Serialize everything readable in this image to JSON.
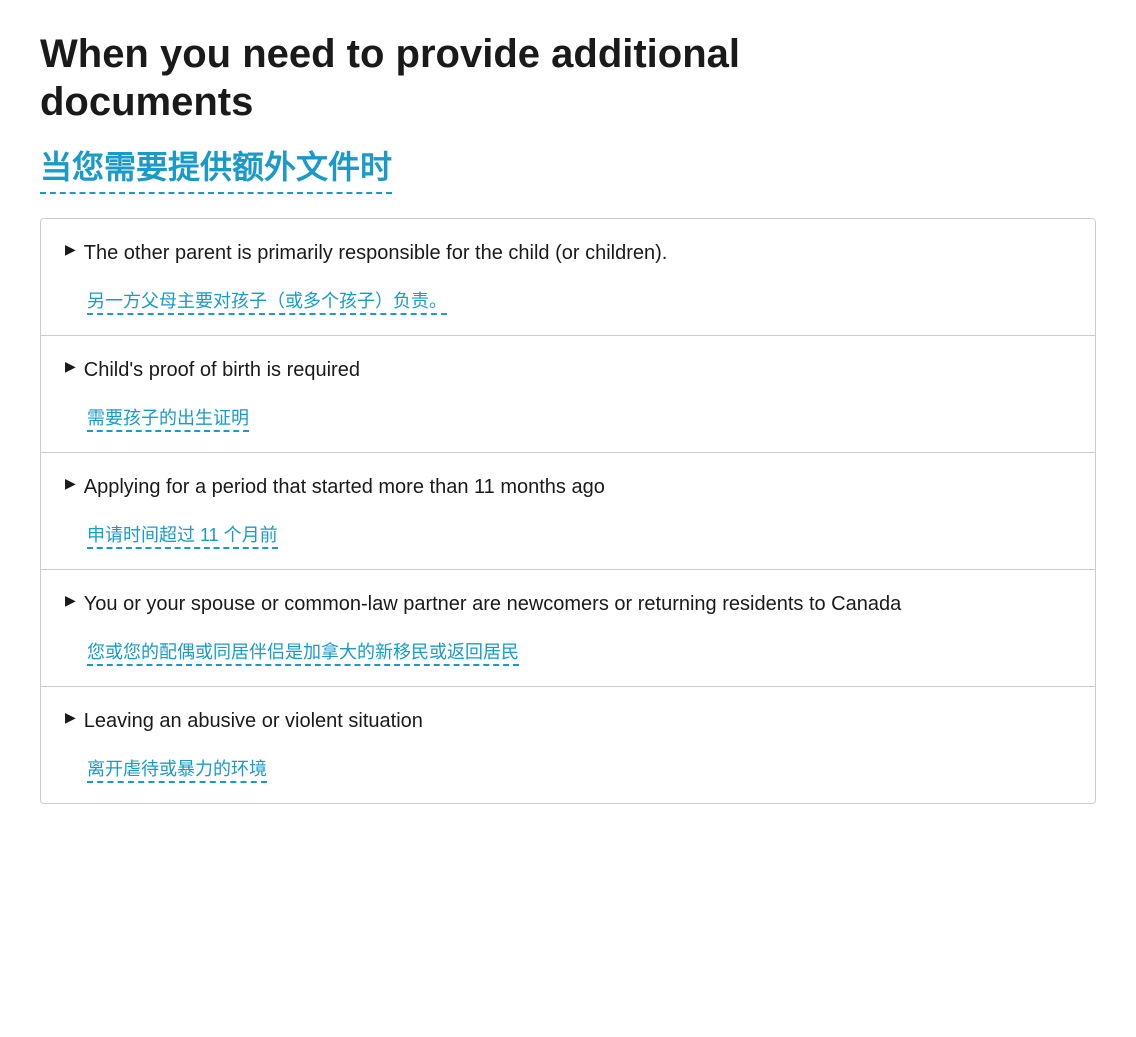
{
  "header": {
    "title_en_line1": "When you need to provide additional",
    "title_en_line2": "documents",
    "title_zh": "当您需要提供额外文件时"
  },
  "accordion": {
    "items": [
      {
        "id": "item-1",
        "title_en": "The other parent is primarily responsible for the child (or children).",
        "title_zh": "另一方父母主要对孩子（或多个孩子）负责。"
      },
      {
        "id": "item-2",
        "title_en": "Child's proof of birth is required",
        "title_zh": "需要孩子的出生证明"
      },
      {
        "id": "item-3",
        "title_en": "Applying for a period that started more than 11 months ago",
        "title_zh": "申请时间超过 11 个月前"
      },
      {
        "id": "item-4",
        "title_en": "You or your spouse or common-law partner are newcomers or returning residents to Canada",
        "title_zh": "您或您的配偶或同居伴侣是加拿大的新移民或返回居民"
      },
      {
        "id": "item-5",
        "title_en": "Leaving an abusive or violent situation",
        "title_zh": "离开虐待或暴力的环境"
      }
    ]
  }
}
